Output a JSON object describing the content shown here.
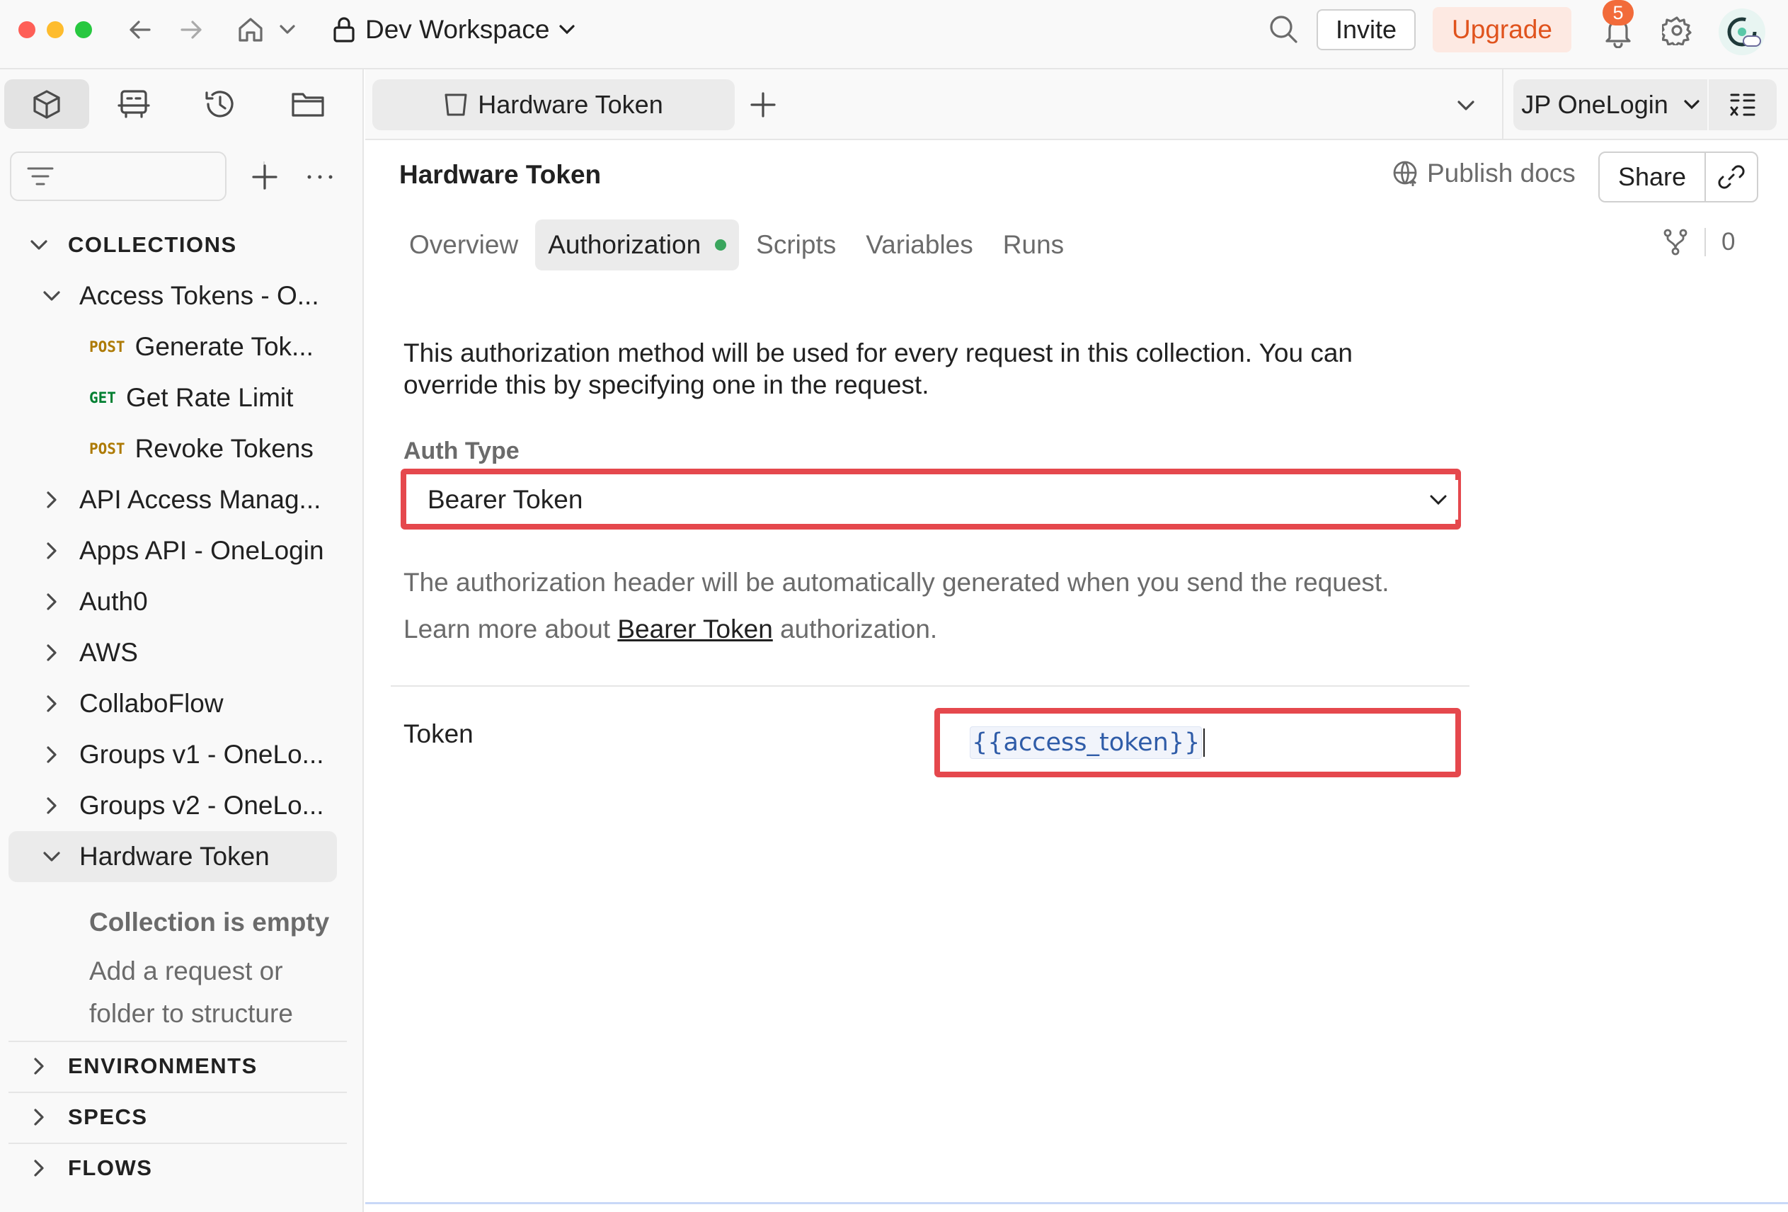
{
  "titlebar": {
    "workspace": "Dev Workspace",
    "invite_label": "Invite",
    "upgrade_label": "Upgrade",
    "notification_count": "5"
  },
  "sidebar": {
    "collections_label": "COLLECTIONS",
    "items": [
      {
        "label": "Access Tokens - O...",
        "expanded": true
      },
      {
        "method": "POST",
        "label": "Generate Tok..."
      },
      {
        "method": "GET",
        "label": "Get Rate Limit"
      },
      {
        "method": "POST",
        "label": "Revoke Tokens"
      },
      {
        "label": "API Access Manag..."
      },
      {
        "label": "Apps API - OneLogin"
      },
      {
        "label": "Auth0"
      },
      {
        "label": "AWS"
      },
      {
        "label": "CollaboFlow"
      },
      {
        "label": "Groups v1 - OneLo..."
      },
      {
        "label": "Groups v2 - OneLo..."
      },
      {
        "label": "Hardware Token",
        "expanded": true,
        "selected": true
      }
    ],
    "empty_title": "Collection is empty",
    "empty_desc": "Add a request or folder to structure",
    "sections": [
      "ENVIRONMENTS",
      "SPECS",
      "FLOWS"
    ]
  },
  "tabbar": {
    "active_tab": "Hardware Token",
    "environment": "JP OneLogin"
  },
  "main": {
    "title": "Hardware Token",
    "publish_label": "Publish docs",
    "share_label": "Share",
    "tabs": [
      "Overview",
      "Authorization",
      "Scripts",
      "Variables",
      "Runs"
    ],
    "active_tab": "Authorization",
    "fork_count": "0",
    "description": "This authorization method will be used for every request in this collection. You can override this by specifying one in the request.",
    "auth_type_label": "Auth Type",
    "auth_type_value": "Bearer Token",
    "help_line1": "The authorization header will be automatically generated when you send the request.",
    "help_line2_prefix": "Learn more about",
    "help_link": "Bearer Token",
    "help_line2_suffix": "authorization.",
    "token_label": "Token",
    "token_value": "{{access_token}}"
  },
  "colors": {
    "highlight": "#e5484d",
    "upgrade": "#e0531d",
    "post": "#ad7a03",
    "get": "#007f31",
    "variable": "#2f5ca8"
  }
}
